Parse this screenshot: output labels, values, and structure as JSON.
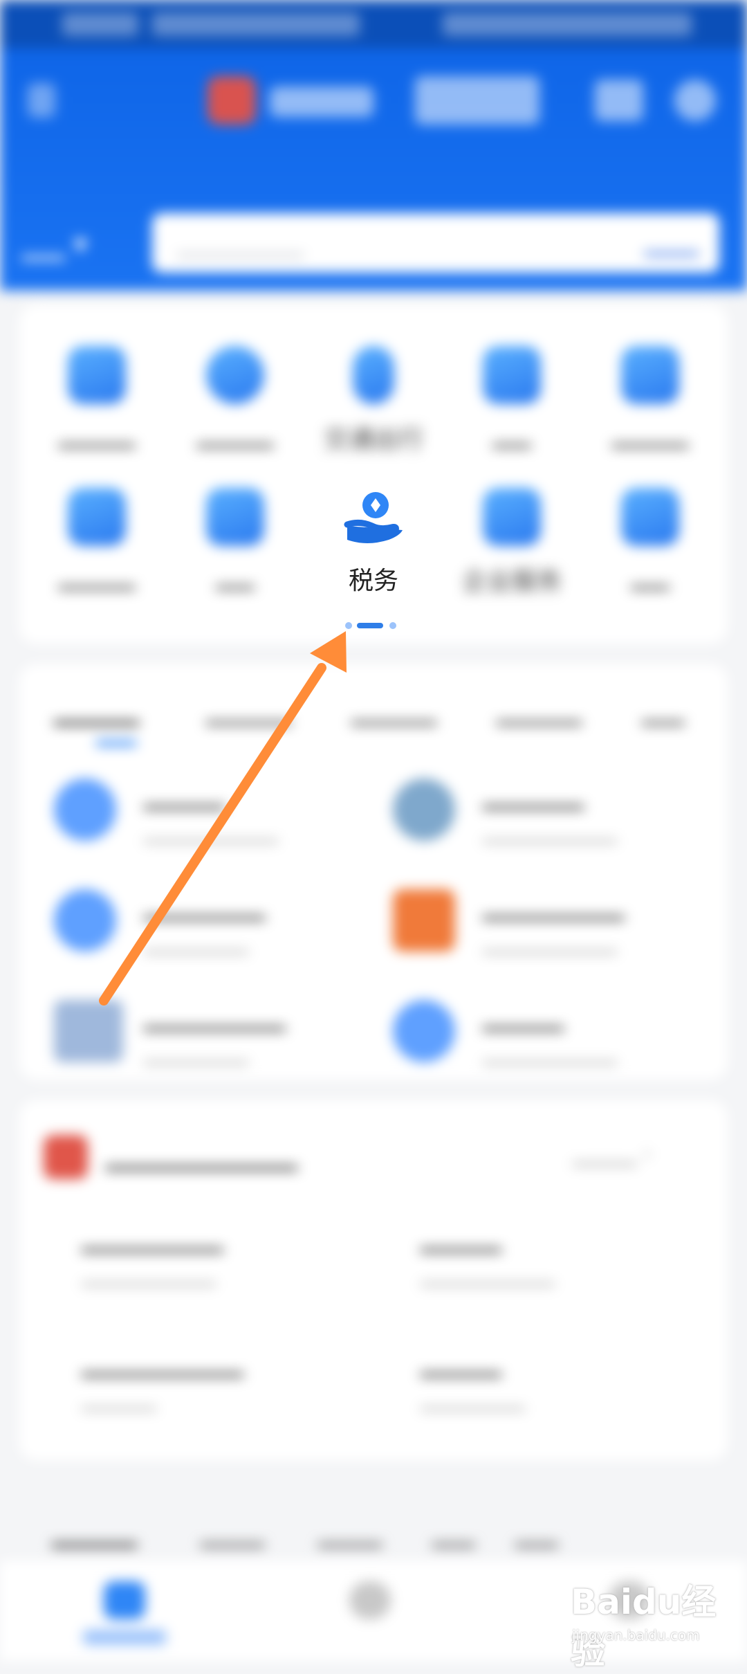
{
  "focus_item": {
    "label": "税务",
    "icon": "hand-holding-tax-icon"
  },
  "visible_partial_labels": {
    "traffic": "交通出行",
    "enterprise": "企业服务"
  },
  "pagination": {
    "total": 3,
    "active": 1
  },
  "watermark": {
    "brand": "Baidu经验",
    "url": "jingyan.baidu.com"
  },
  "colors": {
    "header_blue": "#1a73f2",
    "arrow": "#ff8c38",
    "accent": "#2f86f6"
  }
}
